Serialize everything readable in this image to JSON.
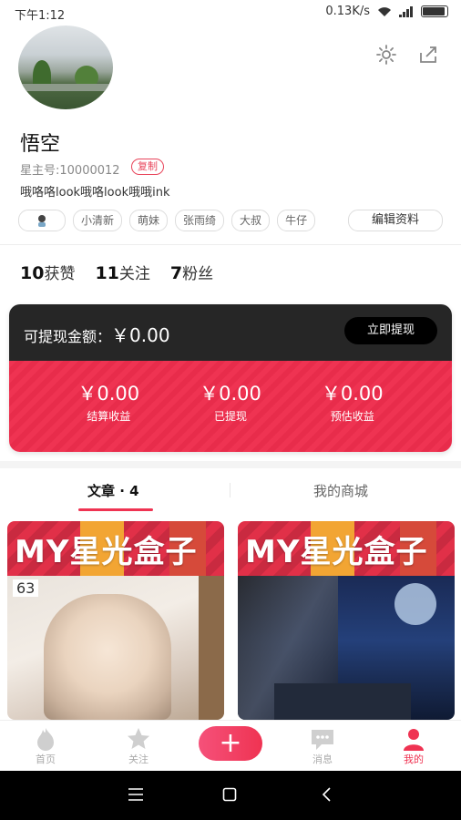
{
  "status_bar": {
    "time": "下午1:12",
    "speed": "0.13K/s"
  },
  "profile": {
    "name": "悟空",
    "star_id": "星主号:10000012",
    "copy_label": "复制",
    "bio": "哦咯咯look哦咯look哦哦ink",
    "tags": [
      "小清新",
      "萌妹",
      "张雨绮",
      "大叔",
      "牛仔"
    ],
    "edit_label": "编辑资料"
  },
  "stats": [
    {
      "num": "10",
      "label": "获赞"
    },
    {
      "num": "11",
      "label": "关注"
    },
    {
      "num": "7",
      "label": "粉丝"
    }
  ],
  "wallet": {
    "withdrawable_label": "可提现金额：",
    "withdrawable_amount": "￥0.00",
    "withdraw_button": "立即提现",
    "items": [
      {
        "value": "￥0.00",
        "label": "结算收益"
      },
      {
        "value": "￥0.00",
        "label": "已提现"
      },
      {
        "value": "￥0.00",
        "label": "预估收益"
      }
    ]
  },
  "tabs": {
    "articles": "文章 · 4",
    "mall": "我的商城"
  },
  "cards": [
    {
      "title": "MY星光盒子",
      "issue": "63"
    },
    {
      "title": "MY星光盒子"
    }
  ],
  "nav": {
    "home": "首页",
    "follow": "关注",
    "add": "+",
    "messages": "消息",
    "me": "我的"
  },
  "colors": {
    "accent": "#ef3352",
    "dark": "#262626"
  }
}
